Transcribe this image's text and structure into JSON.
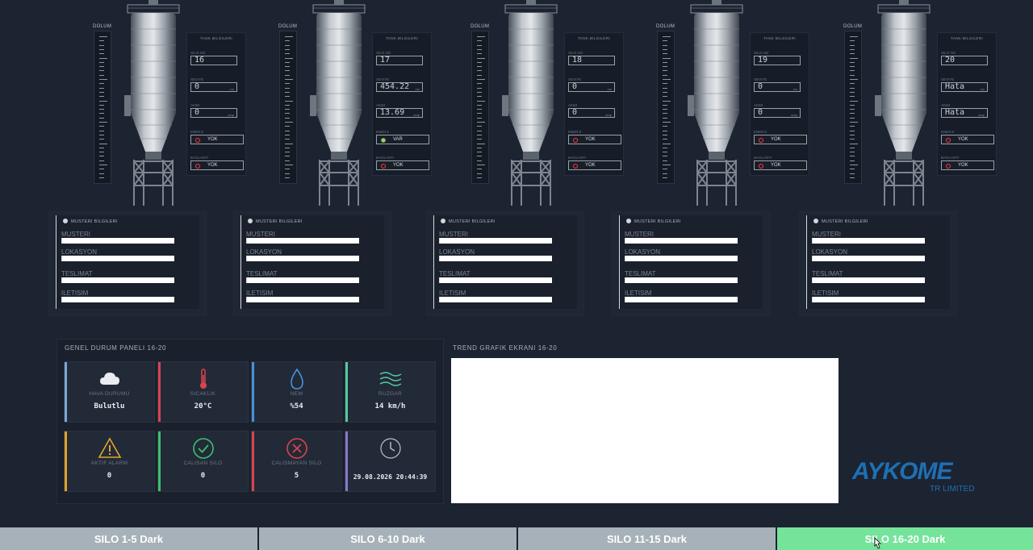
{
  "silos": [
    {
      "no": "16",
      "seviye": "0",
      "akim": "0",
      "enerji": "YOK",
      "baglanti": "YOK",
      "enerji_on": false
    },
    {
      "no": "17",
      "seviye": "454.22",
      "akim": "13.69",
      "enerji": "VAR",
      "baglanti": "YOK",
      "enerji_on": true
    },
    {
      "no": "18",
      "seviye": "0",
      "akim": "0",
      "enerji": "YOK",
      "baglanti": "YOK",
      "enerji_on": false
    },
    {
      "no": "19",
      "seviye": "0",
      "akim": "0",
      "enerji": "YOK",
      "baglanti": "YOK",
      "enerji_on": false
    },
    {
      "no": "20",
      "seviye": "Hata",
      "akim": "Hata",
      "enerji": "YOK",
      "baglanti": "YOK",
      "enerji_on": false
    }
  ],
  "labels": {
    "dolum": "DOLUM",
    "tank_bilgileri": "TANK BILGILERI",
    "silo_no": "SILO NO",
    "seviye": "SEVIYE",
    "akim": "AKIM",
    "enerji": "ENERJI",
    "baglanti": "BAGLANTI",
    "seviye_unit": "cm",
    "akim_unit": "amp",
    "musteri_bilgileri": "MUSTERI BILGILERI",
    "musteri": "MUSTERI",
    "lokasyon": "LOKASYON",
    "teslimat": "TESLIMAT",
    "iletisim": "ILETISIM"
  },
  "genel": {
    "title": "GENEL DURUM PANELI 16-20",
    "hava_label": "HAVA DURUMU",
    "hava_value": "Bulutlu",
    "sicaklik_label": "SICAKLIK",
    "sicaklik_value": "20°C",
    "nem_label": "NEM",
    "nem_value": "%54",
    "ruzgar_label": "RUZGAR",
    "ruzgar_value": "14 km/h",
    "alarm_label": "AKTIF ALARM",
    "alarm_value": "0",
    "calisan_label": "CALISAN SILO",
    "calisan_value": "0",
    "calismayan_label": "CALISMAYAN SILO",
    "calismayan_value": "5",
    "datetime": "29.08.2026 20:44:39"
  },
  "trend": {
    "title": "TREND GRAFIK EKRANI 16-20"
  },
  "logo": {
    "word": "AYKOME",
    "sub": "TR LIMITED"
  },
  "tabs": [
    {
      "label": "SILO 1-5 Dark",
      "active": false
    },
    {
      "label": "SILO 6-10 Dark",
      "active": false
    },
    {
      "label": "SILO 11-15 Dark",
      "active": false
    },
    {
      "label": "SILO 16-20 Dark",
      "active": true
    }
  ],
  "colors": {
    "bg": "#1c2331",
    "tab_inactive": "#a6b1b9",
    "tab_active": "#75e39a",
    "status_red": "#e0444e",
    "status_green": "#9fd46a",
    "logo_blue": "#1f6fb3"
  }
}
